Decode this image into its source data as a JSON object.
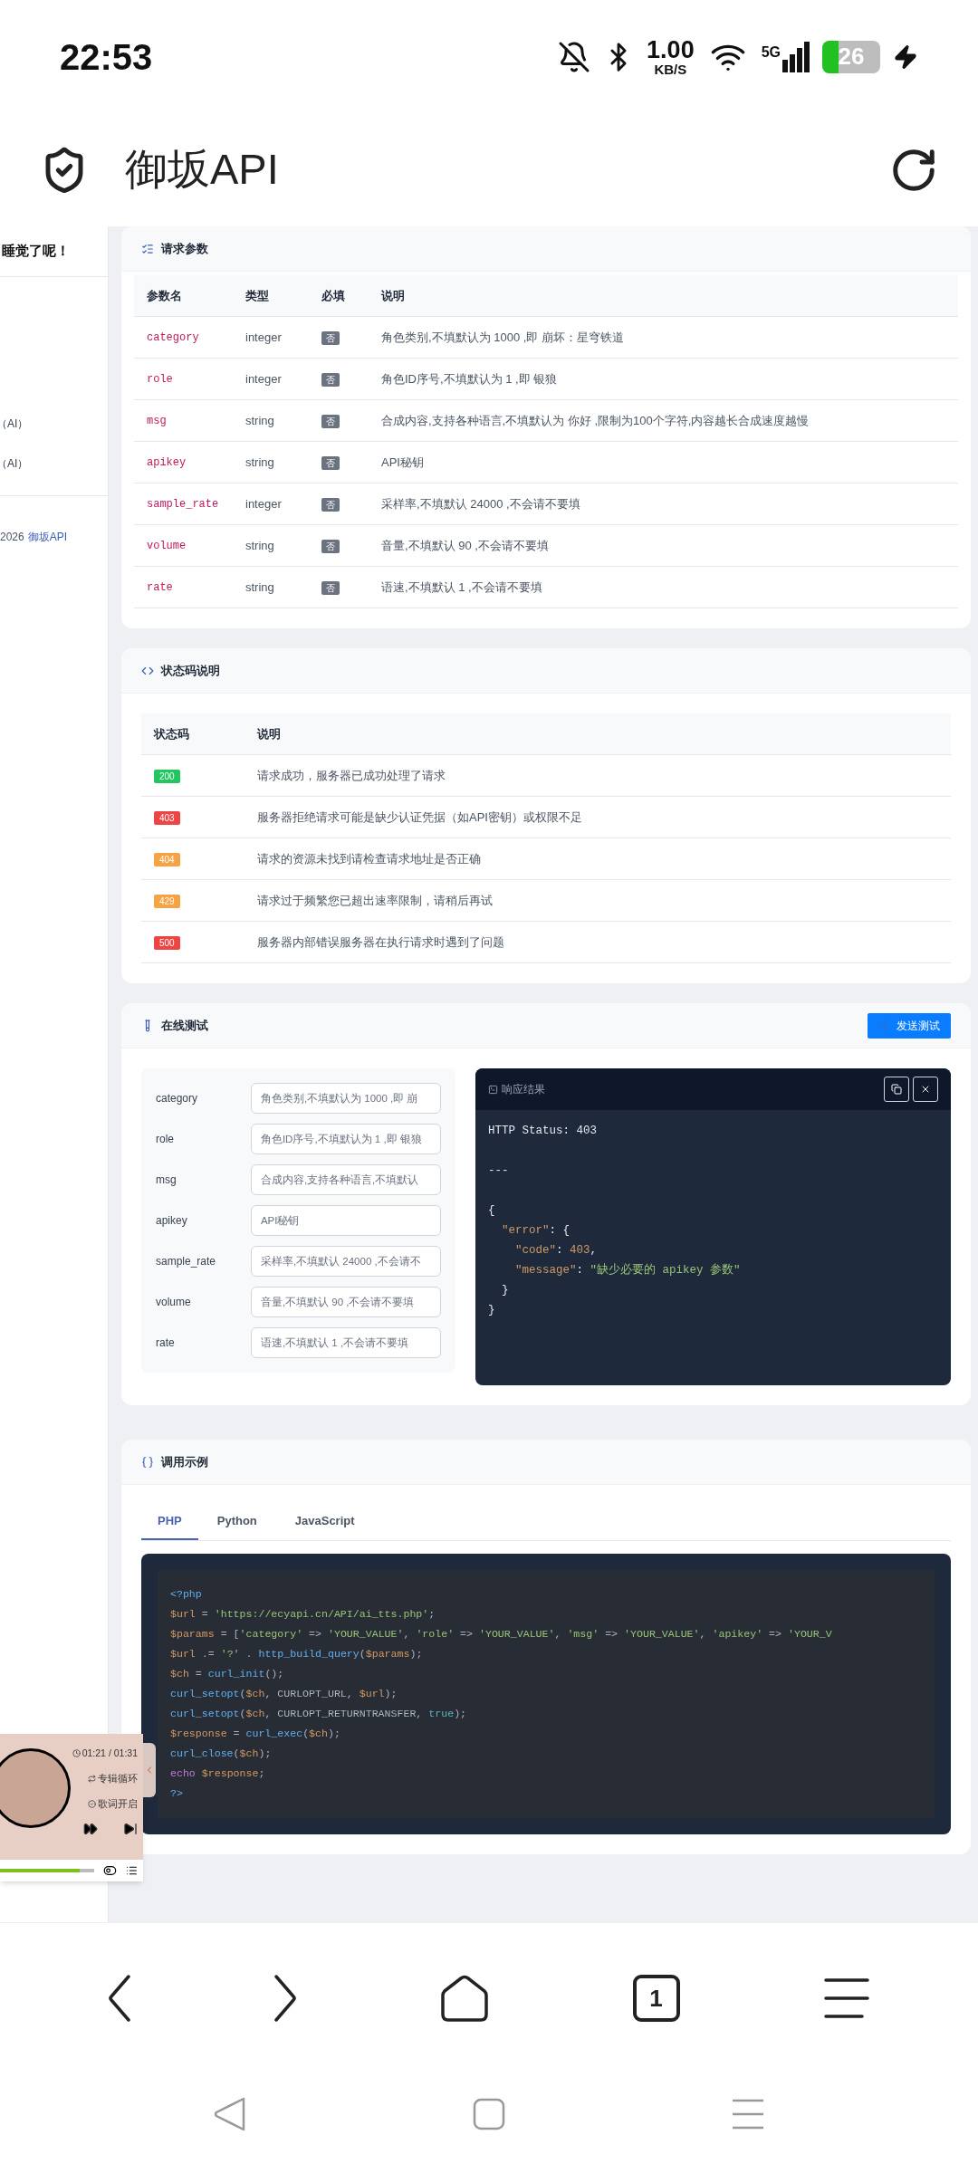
{
  "status_bar": {
    "time": "22:53",
    "net_speed": "1.00",
    "net_unit": "KB/S",
    "network": "5G",
    "battery": "26"
  },
  "browser": {
    "title": "御坂API"
  },
  "sidebar": {
    "texts": [
      "睡觉了呢！",
      "（AI）",
      "（AI）"
    ],
    "footer": {
      "year": "2026",
      "link": "御坂API"
    }
  },
  "params": {
    "title": "请求参数",
    "columns": [
      "参数名",
      "类型",
      "必填",
      "说明"
    ],
    "rows": [
      {
        "name": "category",
        "type": "integer",
        "required": "否",
        "description": "角色类别,不填默认为 1000 ,即 崩坏：星穹铁道"
      },
      {
        "name": "role",
        "type": "integer",
        "required": "否",
        "description": "角色ID序号,不填默认为 1 ,即 银狼"
      },
      {
        "name": "msg",
        "type": "string",
        "required": "否",
        "description": "合成内容,支持各种语言,不填默认为 你好 ,限制为100个字符,内容越长合成速度越慢"
      },
      {
        "name": "apikey",
        "type": "string",
        "required": "否",
        "description": "API秘钥"
      },
      {
        "name": "sample_rate",
        "type": "integer",
        "required": "否",
        "description": "采样率,不填默认 24000 ,不会请不要填"
      },
      {
        "name": "volume",
        "type": "string",
        "required": "否",
        "description": "音量,不填默认 90 ,不会请不要填"
      },
      {
        "name": "rate",
        "type": "string",
        "required": "否",
        "description": "语速,不填默认 1 ,不会请不要填"
      }
    ]
  },
  "status_codes": {
    "title": "状态码说明",
    "columns": [
      "状态码",
      "说明"
    ],
    "rows": [
      {
        "code": "200",
        "color": "#22c55e",
        "description": "请求成功，服务器已成功处理了请求"
      },
      {
        "code": "403",
        "color": "#ef4444",
        "description": "服务器拒绝请求可能是缺少认证凭据（如API密钥）或权限不足"
      },
      {
        "code": "404",
        "color": "#f5a343",
        "description": "请求的资源未找到请检查请求地址是否正确"
      },
      {
        "code": "429",
        "color": "#f5a343",
        "description": "请求过于频繁您已超出速率限制，请稍后再试"
      },
      {
        "code": "500",
        "color": "#ef4444",
        "description": "服务器内部错误服务器在执行请求时遇到了问题"
      }
    ]
  },
  "test": {
    "title": "在线测试",
    "send_button": "发送测试",
    "fields": [
      {
        "label": "category",
        "placeholder": "角色类别,不填默认为 1000 ,即 崩"
      },
      {
        "label": "role",
        "placeholder": "角色ID序号,不填默认为 1 ,即 银狼"
      },
      {
        "label": "msg",
        "placeholder": "合成内容,支持各种语言,不填默认"
      },
      {
        "label": "apikey",
        "placeholder": "API秘钥"
      },
      {
        "label": "sample_rate",
        "placeholder": "采样率,不填默认 24000 ,不会请不"
      },
      {
        "label": "volume",
        "placeholder": "音量,不填默认 90 ,不会请不要填"
      },
      {
        "label": "rate",
        "placeholder": "语速,不填默认 1 ,不会请不要填"
      }
    ],
    "response": {
      "title": "响应结果",
      "lines": [
        {
          "kind": "code",
          "tokens": [
            {
              "kind": "plain",
              "s": "HTTP Status: 403"
            }
          ]
        },
        {
          "kind": "blank"
        },
        {
          "kind": "code",
          "tokens": [
            {
              "kind": "plain",
              "s": "---"
            }
          ]
        },
        {
          "kind": "blank"
        },
        {
          "kind": "code",
          "tokens": [
            {
              "kind": "plain",
              "s": "{"
            }
          ]
        },
        {
          "kind": "code",
          "tokens": [
            {
              "kind": "key",
              "s": "  \"error\""
            },
            {
              "kind": "plain",
              "s": ": {"
            }
          ]
        },
        {
          "kind": "code",
          "tokens": [
            {
              "kind": "key",
              "s": "    \"code\""
            },
            {
              "kind": "plain",
              "s": ": "
            },
            {
              "kind": "num",
              "s": "403"
            },
            {
              "kind": "plain",
              "s": ","
            }
          ]
        },
        {
          "kind": "code",
          "tokens": [
            {
              "kind": "key",
              "s": "    \"message\""
            },
            {
              "kind": "plain",
              "s": ": "
            },
            {
              "kind": "str",
              "s": "\"缺少必要的 apikey 参数\""
            }
          ]
        },
        {
          "kind": "code",
          "tokens": [
            {
              "kind": "plain",
              "s": "  }"
            }
          ]
        },
        {
          "kind": "code",
          "tokens": [
            {
              "kind": "plain",
              "s": "}"
            }
          ]
        }
      ]
    }
  },
  "example": {
    "title": "调用示例",
    "tabs": [
      {
        "label": "PHP",
        "selected": true
      },
      {
        "label": "Python",
        "selected": false
      },
      {
        "label": "JavaScript",
        "selected": false
      }
    ],
    "lines": [
      {
        "kind": "code",
        "tokens": [
          {
            "kind": "tag",
            "s": "<?php"
          }
        ]
      },
      {
        "kind": "code",
        "tokens": [
          {
            "kind": "var",
            "s": "$url"
          },
          {
            "kind": "plain",
            "s": " = "
          },
          {
            "kind": "str",
            "s": "'https://ecyapi.cn/API/ai_tts.php'"
          },
          {
            "kind": "plain",
            "s": ";"
          }
        ]
      },
      {
        "kind": "code",
        "tokens": [
          {
            "kind": "var",
            "s": "$params"
          },
          {
            "kind": "plain",
            "s": " = ["
          },
          {
            "kind": "str",
            "s": "'category'"
          },
          {
            "kind": "plain",
            "s": " => "
          },
          {
            "kind": "str",
            "s": "'YOUR_VALUE'"
          },
          {
            "kind": "plain",
            "s": ", "
          },
          {
            "kind": "str",
            "s": "'role'"
          },
          {
            "kind": "plain",
            "s": " => "
          },
          {
            "kind": "str",
            "s": "'YOUR_VALUE'"
          },
          {
            "kind": "plain",
            "s": ", "
          },
          {
            "kind": "str",
            "s": "'msg'"
          },
          {
            "kind": "plain",
            "s": " => "
          },
          {
            "kind": "str",
            "s": "'YOUR_VALUE'"
          },
          {
            "kind": "plain",
            "s": ", "
          },
          {
            "kind": "str",
            "s": "'apikey'"
          },
          {
            "kind": "plain",
            "s": " => "
          },
          {
            "kind": "str",
            "s": "'YOUR_V"
          }
        ]
      },
      {
        "kind": "code",
        "tokens": [
          {
            "kind": "var",
            "s": "$url"
          },
          {
            "kind": "plain",
            "s": " .= "
          },
          {
            "kind": "str",
            "s": "'?'"
          },
          {
            "kind": "plain",
            "s": " . "
          },
          {
            "kind": "fn",
            "s": "http_build_query"
          },
          {
            "kind": "plain",
            "s": "("
          },
          {
            "kind": "var",
            "s": "$params"
          },
          {
            "kind": "plain",
            "s": ");"
          }
        ]
      },
      {
        "kind": "code",
        "tokens": [
          {
            "kind": "var",
            "s": "$ch"
          },
          {
            "kind": "plain",
            "s": " = "
          },
          {
            "kind": "fn",
            "s": "curl_init"
          },
          {
            "kind": "plain",
            "s": "();"
          }
        ]
      },
      {
        "kind": "code",
        "tokens": [
          {
            "kind": "fn",
            "s": "curl_setopt"
          },
          {
            "kind": "plain",
            "s": "("
          },
          {
            "kind": "var",
            "s": "$ch"
          },
          {
            "kind": "plain",
            "s": ", CURLOPT_URL, "
          },
          {
            "kind": "var",
            "s": "$url"
          },
          {
            "kind": "plain",
            "s": ");"
          }
        ]
      },
      {
        "kind": "code",
        "tokens": [
          {
            "kind": "fn",
            "s": "curl_setopt"
          },
          {
            "kind": "plain",
            "s": "("
          },
          {
            "kind": "var",
            "s": "$ch"
          },
          {
            "kind": "plain",
            "s": ", CURLOPT_RETURNTRANSFER, "
          },
          {
            "kind": "const",
            "s": "true"
          },
          {
            "kind": "plain",
            "s": ");"
          }
        ]
      },
      {
        "kind": "code",
        "tokens": [
          {
            "kind": "var",
            "s": "$response"
          },
          {
            "kind": "plain",
            "s": " = "
          },
          {
            "kind": "fn",
            "s": "curl_exec"
          },
          {
            "kind": "plain",
            "s": "("
          },
          {
            "kind": "var",
            "s": "$ch"
          },
          {
            "kind": "plain",
            "s": ");"
          }
        ]
      },
      {
        "kind": "code",
        "tokens": [
          {
            "kind": "fn",
            "s": "curl_close"
          },
          {
            "kind": "plain",
            "s": "("
          },
          {
            "kind": "var",
            "s": "$ch"
          },
          {
            "kind": "plain",
            "s": ");"
          }
        ]
      },
      {
        "kind": "code",
        "tokens": [
          {
            "kind": "kw",
            "s": "echo"
          },
          {
            "kind": "var",
            "s": " $response"
          },
          {
            "kind": "plain",
            "s": ";"
          }
        ]
      },
      {
        "kind": "code",
        "tokens": [
          {
            "kind": "tag",
            "s": "?>"
          }
        ]
      }
    ]
  },
  "player": {
    "time": "01:21 / 01:31",
    "loop": "专辑循环",
    "lyrics": "歌词开启",
    "level": 0.85
  },
  "bottom_nav": {
    "tab_count": "1"
  }
}
